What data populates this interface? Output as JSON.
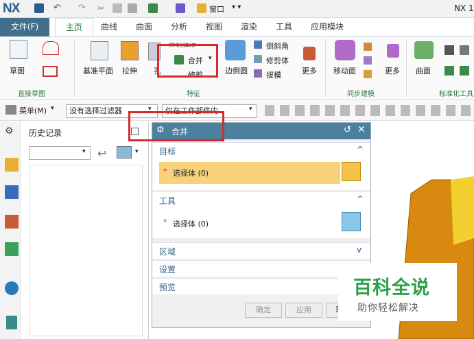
{
  "app": {
    "logo": "NX",
    "title_right": "NX 1",
    "window_menu": "窗口"
  },
  "tabs": {
    "file": "文件(F)",
    "items": [
      "主页",
      "曲线",
      "曲面",
      "分析",
      "视图",
      "渲染",
      "工具",
      "应用模块"
    ]
  },
  "ribbon": {
    "sketch": "草图",
    "sketch_group": "直接草图",
    "datum": "基准平面",
    "extrude": "拉伸",
    "hole": "孔",
    "pattern": "阵列特征",
    "unite": "合并",
    "trim": "修剪",
    "edge_blend": "边倒圆",
    "chamfer": "倒斜角",
    "trim_body": "修剪体",
    "draft": "拔模",
    "more": "更多",
    "feature_group": "特征",
    "move_face": "移动面",
    "sync_more": "更多",
    "sync_group": "同步建模",
    "surface": "曲面",
    "std_group": "标准化工具"
  },
  "cmdbar": {
    "menu": "菜单(M)",
    "filter": "没有选择过滤器",
    "scope": "仅在工作部件内"
  },
  "nav": {
    "title": "历史记录"
  },
  "dialog": {
    "title": "合并",
    "target_section": "目标",
    "target_select": "选择体 (0)",
    "tool_section": "工具",
    "tool_select": "选择体 (0)",
    "region_section": "区域",
    "settings_section": "设置",
    "preview_section": "预览",
    "ok": "确定",
    "apply": "应用",
    "cancel": "取"
  },
  "watermark": {
    "title": "百科全说",
    "subtitle": "助你轻松解决"
  },
  "colors": {
    "accent": "#3f6f8a",
    "highlight": "#f7d27a",
    "red": "#d42a2a",
    "body": "#d88a10"
  }
}
